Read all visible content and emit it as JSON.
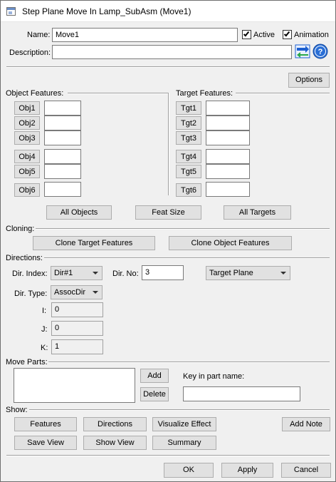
{
  "window": {
    "title": "Step Plane Move In Lamp_SubAsm (Move1)"
  },
  "header": {
    "name_label": "Name:",
    "name_value": "Move1",
    "active_label": "Active",
    "active_checked": true,
    "animation_label": "Animation",
    "animation_checked": true,
    "description_label": "Description:",
    "description_value": "",
    "options_label": "Options"
  },
  "object_features": {
    "heading": "Object Features:",
    "buttons": [
      "Obj1",
      "Obj2",
      "Obj3",
      "Obj4",
      "Obj5",
      "Obj6"
    ]
  },
  "target_features": {
    "heading": "Target Features:",
    "buttons": [
      "Tgt1",
      "Tgt2",
      "Tgt3",
      "Tgt4",
      "Tgt5",
      "Tgt6"
    ]
  },
  "feature_actions": {
    "all_objects": "All Objects",
    "feat_size": "Feat Size",
    "all_targets": "All Targets"
  },
  "cloning": {
    "heading": "Cloning:",
    "clone_target": "Clone Target Features",
    "clone_object": "Clone Object Features"
  },
  "directions": {
    "heading": "Directions:",
    "dir_index_label": "Dir. Index:",
    "dir_index_value": "Dir#1",
    "dir_no_label": "Dir. No:",
    "dir_no_value": "3",
    "plane_value": "Target Plane",
    "dir_type_label": "Dir. Type:",
    "dir_type_value": "AssocDir",
    "i_label": "I:",
    "i_value": "0",
    "j_label": "J:",
    "j_value": "0",
    "k_label": "K:",
    "k_value": "1"
  },
  "move_parts": {
    "heading": "Move Parts:",
    "add_label": "Add",
    "delete_label": "Delete",
    "key_label": "Key in part name:",
    "key_value": ""
  },
  "show": {
    "heading": "Show:",
    "features": "Features",
    "directions": "Directions",
    "visualize_effect": "Visualize Effect",
    "add_note": "Add Note",
    "save_view": "Save View",
    "show_view": "Show View",
    "summary": "Summary"
  },
  "footer": {
    "ok": "OK",
    "apply": "Apply",
    "cancel": "Cancel"
  },
  "icons": {
    "swap": "swap-direction-icon",
    "help": "help-icon"
  },
  "colors": {
    "help_blue": "#2a6fd6",
    "swap_green": "#2aa84a",
    "swap_blue": "#1c5fd0"
  }
}
